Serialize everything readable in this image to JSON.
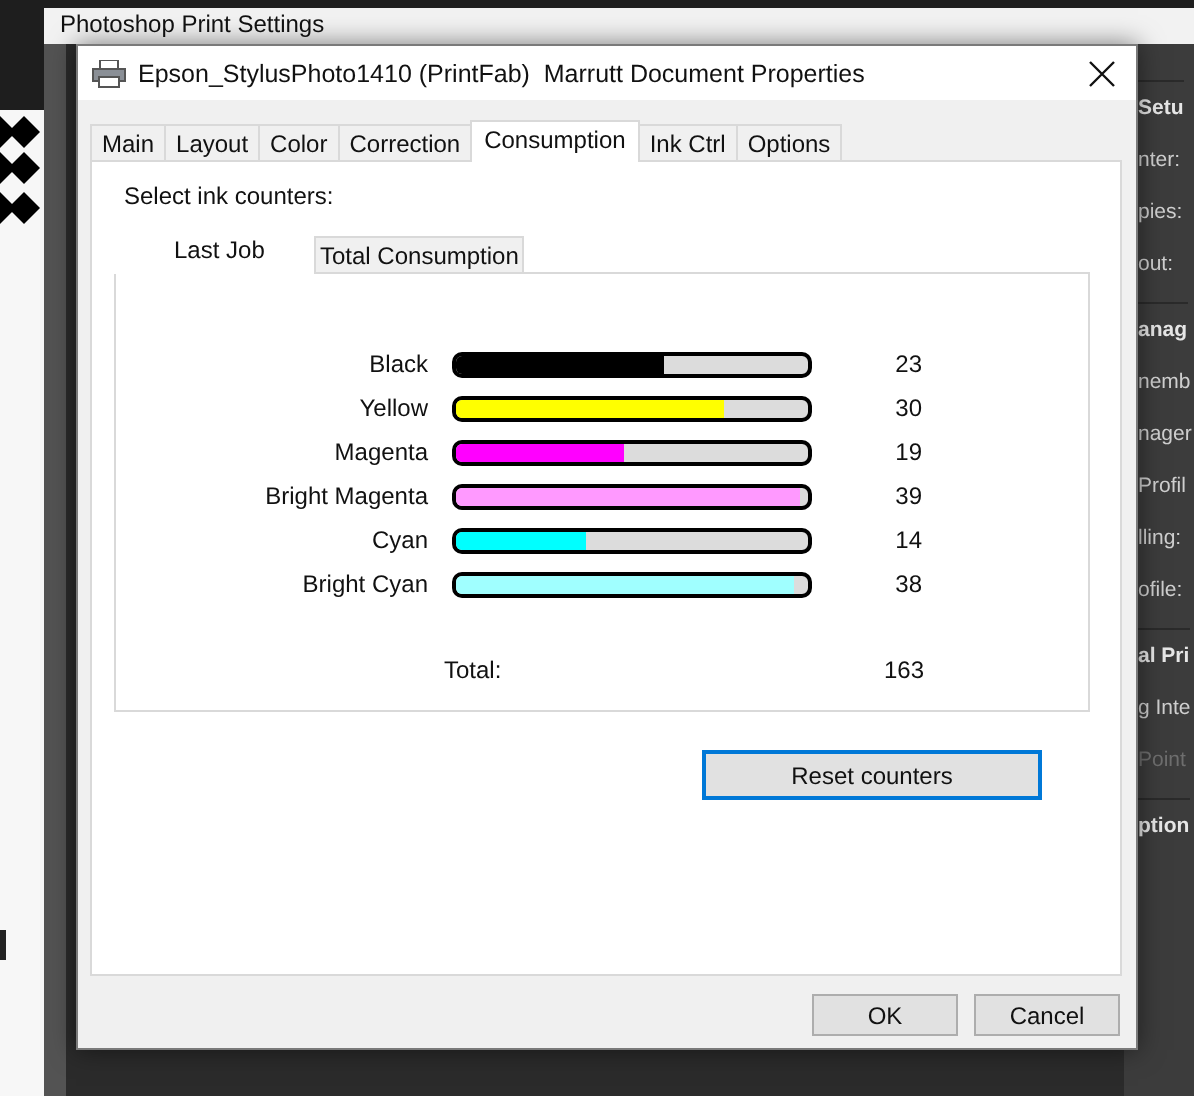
{
  "background_window": {
    "title": "Photoshop Print Settings",
    "side_panel": [
      {
        "text": "Setu",
        "kind": "heading"
      },
      {
        "text": "nter:",
        "kind": "label"
      },
      {
        "text": "pies:",
        "kind": "label"
      },
      {
        "text": "out:",
        "kind": "label"
      },
      {
        "text": "anag",
        "kind": "heading"
      },
      {
        "text": "nemb",
        "kind": "label"
      },
      {
        "text": "nager",
        "kind": "label"
      },
      {
        "text": "Profil",
        "kind": "label"
      },
      {
        "text": "lling:",
        "kind": "label"
      },
      {
        "text": "ofile:",
        "kind": "label"
      },
      {
        "text": "al Pri",
        "kind": "heading"
      },
      {
        "text": "g Inte",
        "kind": "label"
      },
      {
        "text": "Point",
        "kind": "disabled"
      },
      {
        "text": "ption",
        "kind": "heading"
      }
    ]
  },
  "dialog": {
    "title": "Epson_StylusPhoto1410 (PrintFab)  Marrutt Document Properties",
    "tabs": [
      {
        "label": "Main",
        "selected": false
      },
      {
        "label": "Layout",
        "selected": false
      },
      {
        "label": "Color",
        "selected": false
      },
      {
        "label": "Correction",
        "selected": false
      },
      {
        "label": "Consumption",
        "selected": true
      },
      {
        "label": "Ink Ctrl",
        "selected": false
      },
      {
        "label": "Options",
        "selected": false
      }
    ],
    "prompt": "Select ink counters:",
    "subtabs": [
      {
        "label": "Last Job",
        "selected": true
      },
      {
        "label": "Total Consumption",
        "selected": false
      }
    ],
    "inks": [
      {
        "name": "Black",
        "color": "#000000",
        "level": 0.59,
        "count": "23"
      },
      {
        "name": "Yellow",
        "color": "#ffff00",
        "level": 0.76,
        "count": "30"
      },
      {
        "name": "Magenta",
        "color": "#ff00ff",
        "level": 0.48,
        "count": "19"
      },
      {
        "name": "Bright Magenta",
        "color": "#ff99ff",
        "level": 0.98,
        "count": "39"
      },
      {
        "name": "Cyan",
        "color": "#00ffff",
        "level": 0.37,
        "count": "14"
      },
      {
        "name": "Bright Cyan",
        "color": "#a0ffff",
        "level": 0.96,
        "count": "38"
      }
    ],
    "total": {
      "label": "Total:",
      "value": "163"
    },
    "reset_button": "Reset counters",
    "buttons": [
      "OK",
      "Cancel"
    ]
  }
}
